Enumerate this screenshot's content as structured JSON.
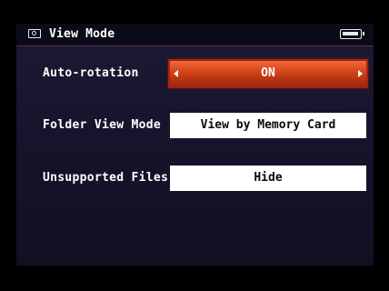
{
  "header": {
    "title": "View Mode",
    "mode_icon": "playback-mode-icon",
    "battery_icon": "battery-full-icon"
  },
  "settings": [
    {
      "label": "Auto-rotation",
      "value": "ON",
      "selected": true
    },
    {
      "label": "Folder View Mode",
      "value": "View by Memory Card",
      "selected": false
    },
    {
      "label": "Unsupported Files",
      "value": "Hide",
      "selected": false
    }
  ],
  "colors": {
    "background": "#15132a",
    "selected_fill": "#d94a1e",
    "selected_border": "#a1241a",
    "value_fill": "#ffffff"
  }
}
